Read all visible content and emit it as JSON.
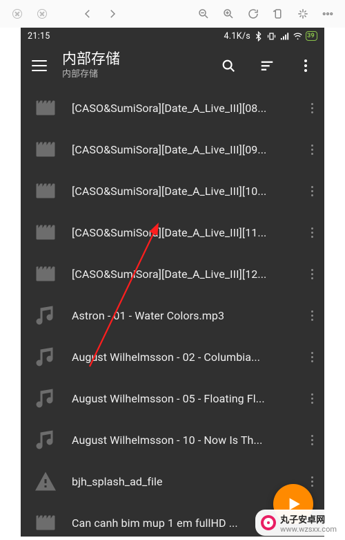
{
  "browser_toolbar": {
    "close": "close",
    "stop": "stop",
    "back": "back",
    "forward": "forward",
    "zoom_out": "zoom-out",
    "zoom_in": "zoom-in",
    "reload": "reload",
    "rotate": "rotate",
    "sparkle": "sparkle",
    "more": "more"
  },
  "status": {
    "time": "21:15",
    "net_speed": "4.1K/s",
    "battery_text": "39"
  },
  "appbar": {
    "title": "内部存储",
    "subtitle": "内部存储"
  },
  "files": [
    {
      "type": "video",
      "name": "[CASO&SumiSora][Date_A_Live_III][08..."
    },
    {
      "type": "video",
      "name": "[CASO&SumiSora][Date_A_Live_III][09..."
    },
    {
      "type": "video",
      "name": "[CASO&SumiSora][Date_A_Live_III][10..."
    },
    {
      "type": "video",
      "name": "[CASO&SumiSora][Date_A_Live_III][11..."
    },
    {
      "type": "video",
      "name": "[CASO&SumiSora][Date_A_Live_III][12..."
    },
    {
      "type": "audio",
      "name": "Astron - 01 - Water Colors.mp3"
    },
    {
      "type": "audio",
      "name": "August Wilhelmsson - 02 - Columbia..."
    },
    {
      "type": "audio",
      "name": "August Wilhelmsson - 05 - Floating Fl..."
    },
    {
      "type": "audio",
      "name": "August Wilhelmsson - 10 - Now Is Th..."
    },
    {
      "type": "warn",
      "name": "bjh_splash_ad_file"
    },
    {
      "type": "video",
      "name": "Can canh bim mup 1 em fullHD ..."
    }
  ],
  "watermark": {
    "name": "丸子安卓网",
    "url": "www.wzsxx.com"
  }
}
